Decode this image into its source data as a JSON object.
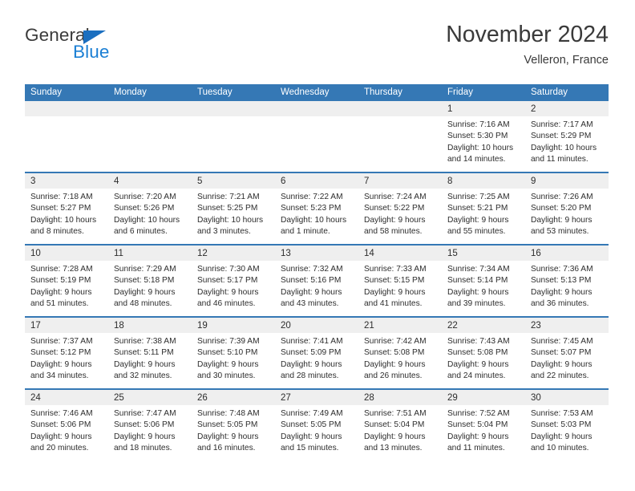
{
  "brand": {
    "name_part1": "General",
    "name_part2": "Blue",
    "icon": "triangle-logo-icon"
  },
  "header": {
    "title": "November 2024",
    "subtitle": "Velleron, France"
  },
  "colors": {
    "header_blue": "#3578b5",
    "brand_blue": "#1b7fd4",
    "day_band_gray": "#efefef",
    "text": "#2d2d2d"
  },
  "weekdays": [
    "Sunday",
    "Monday",
    "Tuesday",
    "Wednesday",
    "Thursday",
    "Friday",
    "Saturday"
  ],
  "labels": {
    "sunrise": "Sunrise:",
    "sunset": "Sunset:",
    "daylight": "Daylight:"
  },
  "weeks": [
    [
      {
        "day": "",
        "line1": "",
        "line2": "",
        "line3": "",
        "line4": ""
      },
      {
        "day": "",
        "line1": "",
        "line2": "",
        "line3": "",
        "line4": ""
      },
      {
        "day": "",
        "line1": "",
        "line2": "",
        "line3": "",
        "line4": ""
      },
      {
        "day": "",
        "line1": "",
        "line2": "",
        "line3": "",
        "line4": ""
      },
      {
        "day": "",
        "line1": "",
        "line2": "",
        "line3": "",
        "line4": ""
      },
      {
        "day": "1",
        "line1": "Sunrise: 7:16 AM",
        "line2": "Sunset: 5:30 PM",
        "line3": "Daylight: 10 hours",
        "line4": "and 14 minutes."
      },
      {
        "day": "2",
        "line1": "Sunrise: 7:17 AM",
        "line2": "Sunset: 5:29 PM",
        "line3": "Daylight: 10 hours",
        "line4": "and 11 minutes."
      }
    ],
    [
      {
        "day": "3",
        "line1": "Sunrise: 7:18 AM",
        "line2": "Sunset: 5:27 PM",
        "line3": "Daylight: 10 hours",
        "line4": "and 8 minutes."
      },
      {
        "day": "4",
        "line1": "Sunrise: 7:20 AM",
        "line2": "Sunset: 5:26 PM",
        "line3": "Daylight: 10 hours",
        "line4": "and 6 minutes."
      },
      {
        "day": "5",
        "line1": "Sunrise: 7:21 AM",
        "line2": "Sunset: 5:25 PM",
        "line3": "Daylight: 10 hours",
        "line4": "and 3 minutes."
      },
      {
        "day": "6",
        "line1": "Sunrise: 7:22 AM",
        "line2": "Sunset: 5:23 PM",
        "line3": "Daylight: 10 hours",
        "line4": "and 1 minute."
      },
      {
        "day": "7",
        "line1": "Sunrise: 7:24 AM",
        "line2": "Sunset: 5:22 PM",
        "line3": "Daylight: 9 hours",
        "line4": "and 58 minutes."
      },
      {
        "day": "8",
        "line1": "Sunrise: 7:25 AM",
        "line2": "Sunset: 5:21 PM",
        "line3": "Daylight: 9 hours",
        "line4": "and 55 minutes."
      },
      {
        "day": "9",
        "line1": "Sunrise: 7:26 AM",
        "line2": "Sunset: 5:20 PM",
        "line3": "Daylight: 9 hours",
        "line4": "and 53 minutes."
      }
    ],
    [
      {
        "day": "10",
        "line1": "Sunrise: 7:28 AM",
        "line2": "Sunset: 5:19 PM",
        "line3": "Daylight: 9 hours",
        "line4": "and 51 minutes."
      },
      {
        "day": "11",
        "line1": "Sunrise: 7:29 AM",
        "line2": "Sunset: 5:18 PM",
        "line3": "Daylight: 9 hours",
        "line4": "and 48 minutes."
      },
      {
        "day": "12",
        "line1": "Sunrise: 7:30 AM",
        "line2": "Sunset: 5:17 PM",
        "line3": "Daylight: 9 hours",
        "line4": "and 46 minutes."
      },
      {
        "day": "13",
        "line1": "Sunrise: 7:32 AM",
        "line2": "Sunset: 5:16 PM",
        "line3": "Daylight: 9 hours",
        "line4": "and 43 minutes."
      },
      {
        "day": "14",
        "line1": "Sunrise: 7:33 AM",
        "line2": "Sunset: 5:15 PM",
        "line3": "Daylight: 9 hours",
        "line4": "and 41 minutes."
      },
      {
        "day": "15",
        "line1": "Sunrise: 7:34 AM",
        "line2": "Sunset: 5:14 PM",
        "line3": "Daylight: 9 hours",
        "line4": "and 39 minutes."
      },
      {
        "day": "16",
        "line1": "Sunrise: 7:36 AM",
        "line2": "Sunset: 5:13 PM",
        "line3": "Daylight: 9 hours",
        "line4": "and 36 minutes."
      }
    ],
    [
      {
        "day": "17",
        "line1": "Sunrise: 7:37 AM",
        "line2": "Sunset: 5:12 PM",
        "line3": "Daylight: 9 hours",
        "line4": "and 34 minutes."
      },
      {
        "day": "18",
        "line1": "Sunrise: 7:38 AM",
        "line2": "Sunset: 5:11 PM",
        "line3": "Daylight: 9 hours",
        "line4": "and 32 minutes."
      },
      {
        "day": "19",
        "line1": "Sunrise: 7:39 AM",
        "line2": "Sunset: 5:10 PM",
        "line3": "Daylight: 9 hours",
        "line4": "and 30 minutes."
      },
      {
        "day": "20",
        "line1": "Sunrise: 7:41 AM",
        "line2": "Sunset: 5:09 PM",
        "line3": "Daylight: 9 hours",
        "line4": "and 28 minutes."
      },
      {
        "day": "21",
        "line1": "Sunrise: 7:42 AM",
        "line2": "Sunset: 5:08 PM",
        "line3": "Daylight: 9 hours",
        "line4": "and 26 minutes."
      },
      {
        "day": "22",
        "line1": "Sunrise: 7:43 AM",
        "line2": "Sunset: 5:08 PM",
        "line3": "Daylight: 9 hours",
        "line4": "and 24 minutes."
      },
      {
        "day": "23",
        "line1": "Sunrise: 7:45 AM",
        "line2": "Sunset: 5:07 PM",
        "line3": "Daylight: 9 hours",
        "line4": "and 22 minutes."
      }
    ],
    [
      {
        "day": "24",
        "line1": "Sunrise: 7:46 AM",
        "line2": "Sunset: 5:06 PM",
        "line3": "Daylight: 9 hours",
        "line4": "and 20 minutes."
      },
      {
        "day": "25",
        "line1": "Sunrise: 7:47 AM",
        "line2": "Sunset: 5:06 PM",
        "line3": "Daylight: 9 hours",
        "line4": "and 18 minutes."
      },
      {
        "day": "26",
        "line1": "Sunrise: 7:48 AM",
        "line2": "Sunset: 5:05 PM",
        "line3": "Daylight: 9 hours",
        "line4": "and 16 minutes."
      },
      {
        "day": "27",
        "line1": "Sunrise: 7:49 AM",
        "line2": "Sunset: 5:05 PM",
        "line3": "Daylight: 9 hours",
        "line4": "and 15 minutes."
      },
      {
        "day": "28",
        "line1": "Sunrise: 7:51 AM",
        "line2": "Sunset: 5:04 PM",
        "line3": "Daylight: 9 hours",
        "line4": "and 13 minutes."
      },
      {
        "day": "29",
        "line1": "Sunrise: 7:52 AM",
        "line2": "Sunset: 5:04 PM",
        "line3": "Daylight: 9 hours",
        "line4": "and 11 minutes."
      },
      {
        "day": "30",
        "line1": "Sunrise: 7:53 AM",
        "line2": "Sunset: 5:03 PM",
        "line3": "Daylight: 9 hours",
        "line4": "and 10 minutes."
      }
    ]
  ]
}
